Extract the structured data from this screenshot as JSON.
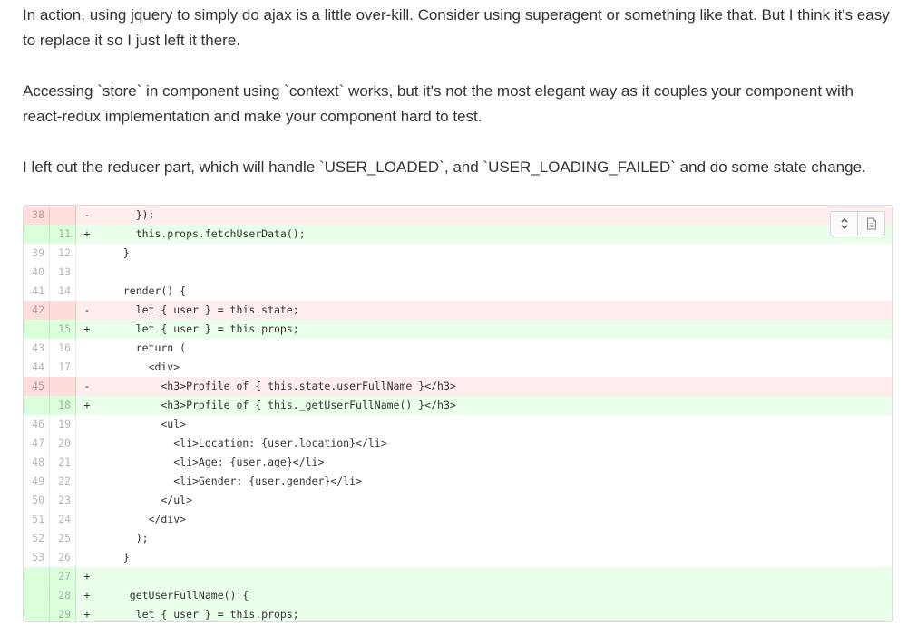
{
  "article": {
    "p1": "In action, using jquery to simply do ajax is a little over-kill. Consider using superagent or something like that. But I think it's easy to replace it so I just left it there.",
    "p2": "Accessing `store` in component using `context` works, but it's not the most elegant way as it couples your component with react-redux implementation and make your component hard to test.",
    "p3": "I left out the reducer part, which will handle `USER_LOADED`, and `USER_LOADING_FAILED` and do some state change."
  },
  "diff": {
    "toolbar": {
      "expand_icon": "unfold-icon",
      "view_icon": "file-icon"
    },
    "colors": {
      "deleted_bg": "#ffecec",
      "added_bg": "#eaffea"
    },
    "lines": [
      {
        "type": "del",
        "old": "38",
        "new": "",
        "marker": "-",
        "code": "    });"
      },
      {
        "type": "add",
        "old": "",
        "new": "11",
        "marker": "+",
        "code": "    this.props.fetchUserData();"
      },
      {
        "type": "ctx",
        "old": "39",
        "new": "12",
        "marker": "",
        "code": "  }"
      },
      {
        "type": "ctx",
        "old": "40",
        "new": "13",
        "marker": "",
        "code": ""
      },
      {
        "type": "ctx",
        "old": "41",
        "new": "14",
        "marker": "",
        "code": "  render() {"
      },
      {
        "type": "del",
        "old": "42",
        "new": "",
        "marker": "-",
        "code": "    let { user } = this.state;"
      },
      {
        "type": "add",
        "old": "",
        "new": "15",
        "marker": "+",
        "code": "    let { user } = this.props;"
      },
      {
        "type": "ctx",
        "old": "43",
        "new": "16",
        "marker": "",
        "code": "    return ("
      },
      {
        "type": "ctx",
        "old": "44",
        "new": "17",
        "marker": "",
        "code": "      <div>"
      },
      {
        "type": "del",
        "old": "45",
        "new": "",
        "marker": "-",
        "code": "        <h3>Profile of { this.state.userFullName }</h3>"
      },
      {
        "type": "add",
        "old": "",
        "new": "18",
        "marker": "+",
        "code": "        <h3>Profile of { this._getUserFullName() }</h3>"
      },
      {
        "type": "ctx",
        "old": "46",
        "new": "19",
        "marker": "",
        "code": "        <ul>"
      },
      {
        "type": "ctx",
        "old": "47",
        "new": "20",
        "marker": "",
        "code": "          <li>Location: {user.location}</li>"
      },
      {
        "type": "ctx",
        "old": "48",
        "new": "21",
        "marker": "",
        "code": "          <li>Age: {user.age}</li>"
      },
      {
        "type": "ctx",
        "old": "49",
        "new": "22",
        "marker": "",
        "code": "          <li>Gender: {user.gender}</li>"
      },
      {
        "type": "ctx",
        "old": "50",
        "new": "23",
        "marker": "",
        "code": "        </ul>"
      },
      {
        "type": "ctx",
        "old": "51",
        "new": "24",
        "marker": "",
        "code": "      </div>"
      },
      {
        "type": "ctx",
        "old": "52",
        "new": "25",
        "marker": "",
        "code": "    );"
      },
      {
        "type": "ctx",
        "old": "53",
        "new": "26",
        "marker": "",
        "code": "  }"
      },
      {
        "type": "add",
        "old": "",
        "new": "27",
        "marker": "+",
        "code": ""
      },
      {
        "type": "add",
        "old": "",
        "new": "28",
        "marker": "+",
        "code": "  _getUserFullName() {"
      },
      {
        "type": "add",
        "old": "",
        "new": "29",
        "marker": "+",
        "code": "    let { user } = this.props;"
      }
    ]
  }
}
